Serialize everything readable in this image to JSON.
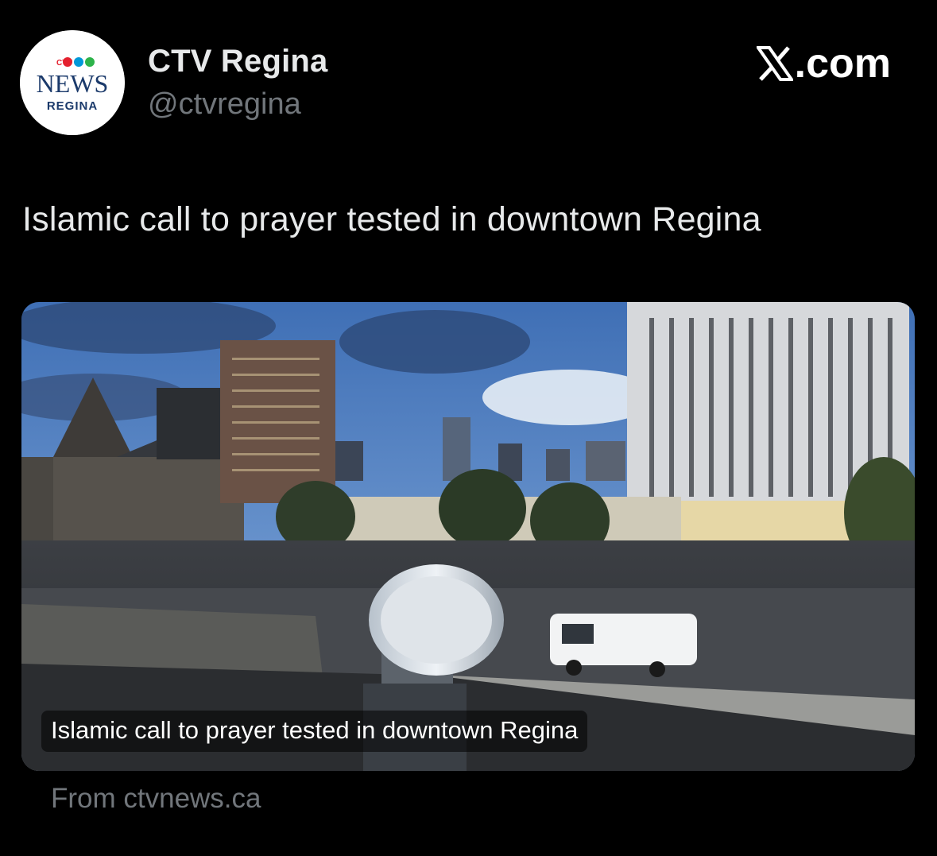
{
  "account": {
    "display_name": "CTV Regina",
    "handle": "@ctvregina",
    "avatar_logo": {
      "brand": "CTV",
      "line1": "NEWS",
      "line2": "REGINA"
    }
  },
  "brand": {
    "label": "X.com",
    "icon": "x-logo-icon"
  },
  "tweet": {
    "text": "Islamic call to prayer tested in downtown Regina"
  },
  "card": {
    "caption": "Islamic call to prayer tested in downtown Regina",
    "source": "From ctvnews.ca"
  },
  "colors": {
    "background": "#000000",
    "text": "#e7e9ea",
    "secondary_text": "#71767b"
  }
}
